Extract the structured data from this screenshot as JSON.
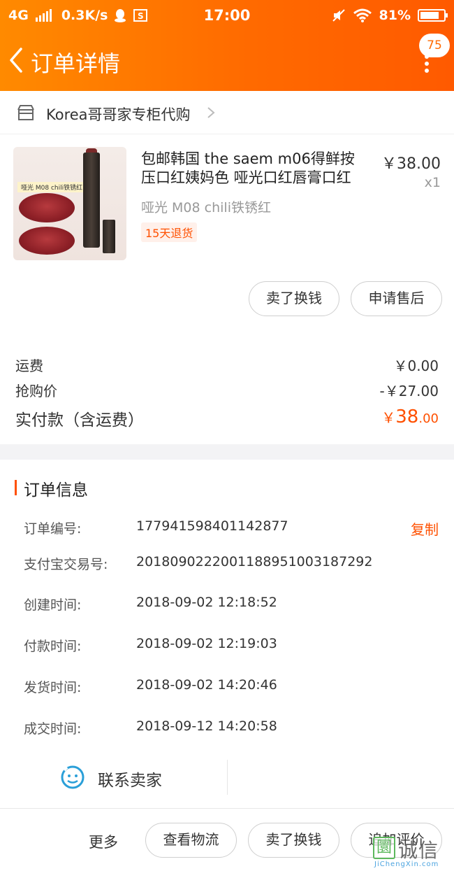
{
  "status_bar": {
    "network": "4G",
    "speed": "0.3K/s",
    "time": "17:00",
    "battery": "81%",
    "battery_level": 0.81
  },
  "nav": {
    "title": "订单详情",
    "badge": "75"
  },
  "shop": {
    "name": "Korea哥哥家专柜代购"
  },
  "item": {
    "thumb_tag": "哑光 M08 chili铁锈红",
    "title": "包邮韩国 the saem m06得鲜按压口红姨妈色 哑光口红唇膏口红",
    "price": "￥38.00",
    "qty": "x1",
    "sku": "哑光 M08 chili铁锈红",
    "badge": "15天退货"
  },
  "item_actions": {
    "sell": "卖了换钱",
    "after_sale": "申请售后"
  },
  "summary": {
    "shipping_label": "运费",
    "shipping_value": "￥0.00",
    "discount_label": "抢购价",
    "discount_value": "-￥27.00",
    "total_label": "实付款（含运费）",
    "total_symbol": "￥",
    "total_int": "38",
    "total_dec": ".00"
  },
  "order_info": {
    "title": "订单信息",
    "rows": [
      {
        "label": "订单编号:",
        "value": "177941598401142877"
      },
      {
        "label": "支付宝交易号:",
        "value": "2018090222001188951003187292"
      },
      {
        "label": "创建时间:",
        "value": "2018-09-02 12:18:52"
      },
      {
        "label": "付款时间:",
        "value": "2018-09-02 12:19:03"
      },
      {
        "label": "发货时间:",
        "value": "2018-09-02 14:20:46"
      },
      {
        "label": "成交时间:",
        "value": "2018-09-12 14:20:58"
      }
    ],
    "copy": "复制"
  },
  "contact": {
    "label": "联系卖家"
  },
  "bottom_bar": {
    "more": "更多",
    "logistics": "查看物流",
    "sell": "卖了换钱",
    "review": "追加评价"
  },
  "watermark": {
    "text": "诚信",
    "url": "JiChengXin.com"
  },
  "colors": {
    "header_start": "#ff8a00",
    "header_end": "#ff5a00",
    "accent": "#ff5000"
  }
}
